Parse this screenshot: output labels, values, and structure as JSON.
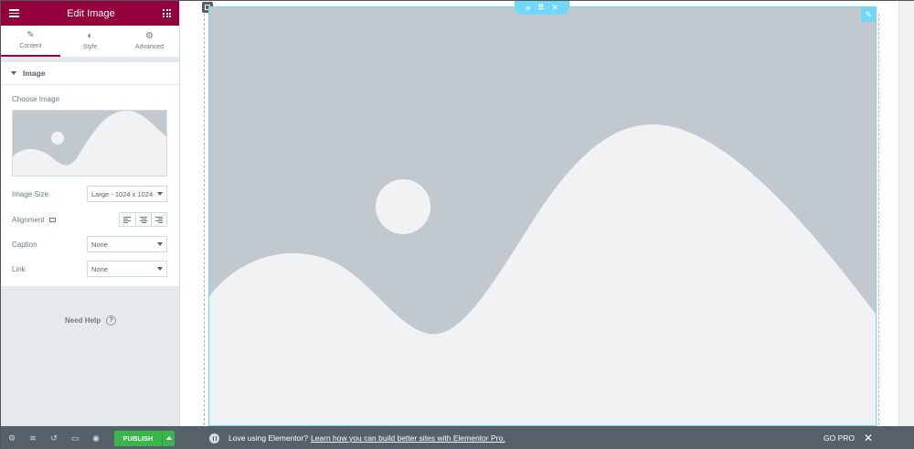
{
  "panel": {
    "title": "Edit Image",
    "tabs": [
      {
        "label": "Content",
        "icon": "pencil-icon"
      },
      {
        "label": "Style",
        "icon": "contrast-icon"
      },
      {
        "label": "Advanced",
        "icon": "gear-icon"
      }
    ],
    "section_title": "Image",
    "choose_image_label": "Choose Image",
    "image_size": {
      "label": "Image Size",
      "value": "Large - 1024 x 1024"
    },
    "alignment": {
      "label": "Alignment"
    },
    "caption": {
      "label": "Caption",
      "value": "None"
    },
    "link": {
      "label": "Link",
      "value": "None"
    },
    "help": "Need Help",
    "help_icon": "?"
  },
  "footer": {
    "publish_label": "PUBLISH"
  },
  "notice": {
    "text": "Love using Elementor?",
    "link_text": "Learn how you can build better sites with Elementor Pro.",
    "go_pro": "GO PRO",
    "close": "✕"
  },
  "colors": {
    "brand": "#93003c",
    "accent": "#71d7f7",
    "publish": "#39b54a",
    "placeholder_bg": "#c1c8ce",
    "placeholder_fg": "#f1f2f3"
  }
}
